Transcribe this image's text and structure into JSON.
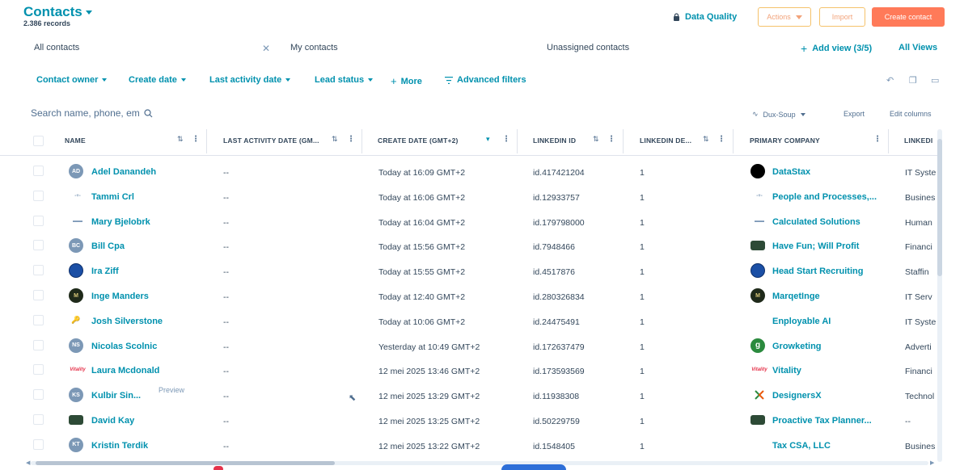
{
  "header": {
    "title": "Contacts",
    "records": "2.386 records",
    "data_quality": "Data Quality",
    "actions_label": "Actions",
    "import_label": "Import",
    "create_label": "Create contact"
  },
  "views": {
    "tabs": [
      "All contacts",
      "My contacts",
      "Unassigned contacts"
    ],
    "add_view": "Add view (3/5)",
    "all_views": "All Views"
  },
  "filters": {
    "items": [
      "Contact owner",
      "Create date",
      "Last activity date",
      "Lead status"
    ],
    "more": "More",
    "advanced": "Advanced filters"
  },
  "toolbar": {
    "search_placeholder": "Search name, phone, em",
    "dux_soup": "Dux-Soup",
    "export": "Export",
    "edit_columns": "Edit columns"
  },
  "table": {
    "columns": [
      "NAME",
      "LAST ACTIVITY DATE (GM...",
      "CREATE DATE (GMT+2)",
      "LINKEDIN ID",
      "LINKEDIN DE...",
      "PRIMARY COMPANY",
      "LINKEDI"
    ],
    "rows": [
      {
        "avatar": "AD",
        "avatar_type": "grey",
        "name": "Adel Danandeh",
        "last": "--",
        "create": "Today at 16:09 GMT+2",
        "lid": "id.417421204",
        "lde": "1",
        "company": "DataStax",
        "comp_type": "black",
        "industry": "IT Syste"
      },
      {
        "avatar": "-+-",
        "avatar_type": "logo",
        "name": "Tammi Crl",
        "last": "--",
        "create": "Today at 16:06 GMT+2",
        "lid": "id.12933757",
        "lde": "1",
        "company": "People and Processes,...",
        "comp_type": "logo",
        "industry": "Busines"
      },
      {
        "avatar": "▬▬",
        "avatar_type": "logo",
        "name": "Mary Bjelobrk",
        "last": "--",
        "create": "Today at 16:04 GMT+2",
        "lid": "id.179798000",
        "lde": "1",
        "company": "Calculated Solutions",
        "comp_type": "logo",
        "industry": "Human"
      },
      {
        "avatar": "BC",
        "avatar_type": "grey",
        "name": "Bill Cpa",
        "last": "--",
        "create": "Today at 15:56 GMT+2",
        "lid": "id.7948466",
        "lde": "1",
        "company": "Have Fun; Will Profit",
        "comp_type": "img",
        "industry": "Financi"
      },
      {
        "avatar": "",
        "avatar_type": "blue",
        "name": "Ira Ziff",
        "last": "--",
        "create": "Today at 15:55 GMT+2",
        "lid": "id.4517876",
        "lde": "1",
        "company": "Head Start Recruiting",
        "comp_type": "blue",
        "industry": "Staffin"
      },
      {
        "avatar": "M",
        "avatar_type": "dark",
        "name": "Inge Manders",
        "last": "--",
        "create": "Today at 12:40 GMT+2",
        "lid": "id.280326834",
        "lde": "1",
        "company": "MarqetInge",
        "comp_type": "dark",
        "industry": "IT Serv"
      },
      {
        "avatar": "",
        "avatar_type": "none",
        "name": "Josh Silverstone",
        "last": "--",
        "create": "Today at 10:06 GMT+2",
        "lid": "id.24475491",
        "lde": "1",
        "company": "Enployable AI",
        "comp_type": "none",
        "industry": "IT Syste"
      },
      {
        "avatar": "NS",
        "avatar_type": "grey",
        "name": "Nicolas Scolnic",
        "last": "--",
        "create": "Yesterday at 10:49 GMT+2",
        "lid": "id.172637479",
        "lde": "1",
        "company": "Growketing",
        "comp_type": "green",
        "industry": "Adverti"
      },
      {
        "avatar": "Vitality",
        "avatar_type": "logo",
        "name": "Laura Mcdonald",
        "last": "--",
        "create": "12 mei 2025 13:46 GMT+2",
        "lid": "id.173593569",
        "lde": "1",
        "company": "Vitality",
        "comp_type": "logo",
        "industry": "Financi"
      },
      {
        "avatar": "KS",
        "avatar_type": "grey",
        "name": "Kulbir Sin...",
        "preview": "Preview",
        "last": "--",
        "create": "12 mei 2025 13:29 GMT+2",
        "lid": "id.11938308",
        "lde": "1",
        "company": "DesignersX",
        "comp_type": "logo",
        "industry": "Technol"
      },
      {
        "avatar": "",
        "avatar_type": "img",
        "name": "David Kay",
        "last": "--",
        "create": "12 mei 2025 13:25 GMT+2",
        "lid": "id.50229759",
        "lde": "1",
        "company": "Proactive Tax Planner...",
        "comp_type": "img",
        "industry": "--"
      },
      {
        "avatar": "KT",
        "avatar_type": "grey",
        "name": "Kristin Terdik",
        "last": "--",
        "create": "12 mei 2025 13:22 GMT+2",
        "lid": "id.1548405",
        "lde": "1",
        "company": "Tax CSA, LLC",
        "comp_type": "none",
        "industry": "Busines"
      }
    ]
  },
  "colors": {
    "accent": "#0091ae",
    "primary_button": "#ff7a59",
    "text": "#33475b"
  }
}
